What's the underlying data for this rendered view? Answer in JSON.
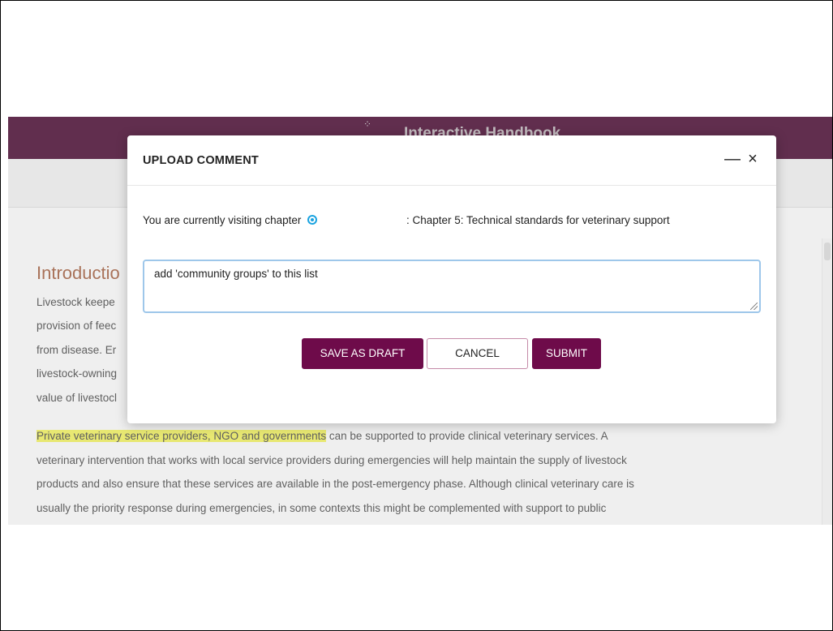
{
  "site": {
    "title": "Interactive Handbook",
    "logo_icon": "dotted-circle-logo"
  },
  "page": {
    "heading": "Introductio",
    "intro_lines": [
      "Livestock keepe",
      "provision of feec",
      "from disease. Er",
      "livestock-owning",
      "value of livestocl"
    ],
    "highlighted_text": "Private veterinary service providers, NGO and governments",
    "para_line1_rest": " can be supported to provide clinical veterinary services. A",
    "para_lines": [
      "veterinary intervention that works with local service providers during emergencies will help maintain the supply of livestock",
      "products and also ensure that these services are available in the post-emergency phase. Although clinical veterinary care is",
      "usually the priority response during emergencies, in some contexts this might be complemented with support to public"
    ],
    "colors": {
      "brand": "#460a2f",
      "highlight": "#e4e45a",
      "heading": "#9a5a3c"
    }
  },
  "modal": {
    "title": "UPLOAD COMMENT",
    "minimize_label": "—",
    "close_label": "×",
    "chapter_prefix": "You are currently visiting chapter",
    "chapter_icon": "info-circle-icon",
    "chapter_name": ": Chapter 5: Technical standards for veterinary support",
    "comment_value": "add 'community groups' to this list",
    "buttons": {
      "draft": "SAVE AS DRAFT",
      "cancel": "CANCEL",
      "submit": "SUBMIT"
    },
    "colors": {
      "primary": "#6e0b4a",
      "info": "#1aa3e0",
      "focus": "#9ec7ea"
    }
  }
}
